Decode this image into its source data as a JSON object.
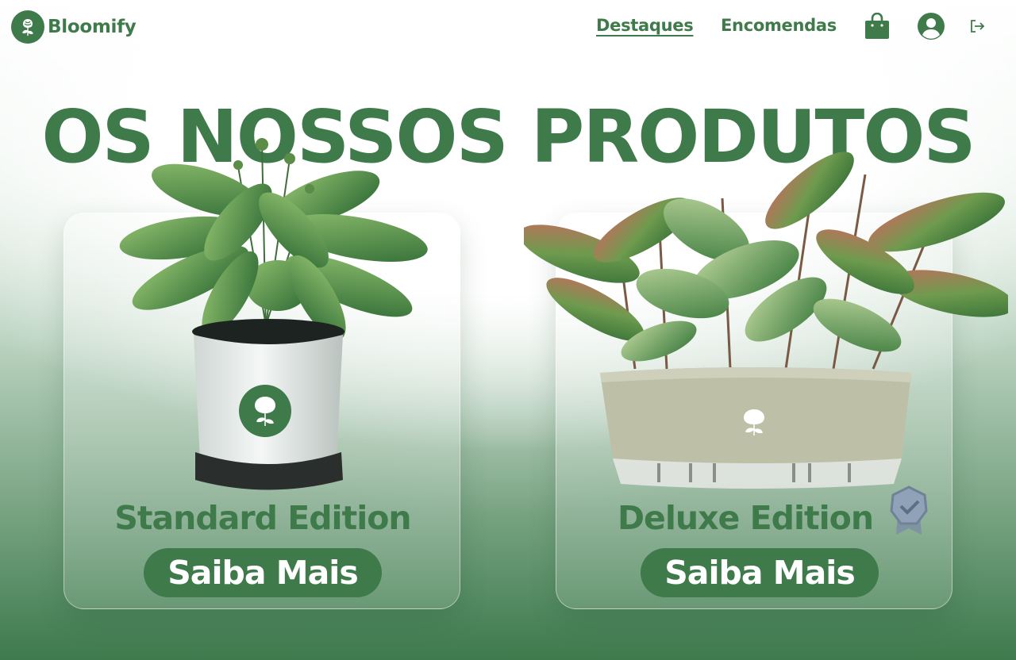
{
  "brand": {
    "name": "Bloomify"
  },
  "nav": {
    "items": [
      {
        "label": "Destaques",
        "active": true
      },
      {
        "label": "Encomendas",
        "active": false
      }
    ],
    "icons": [
      "shopping-bag-icon",
      "user-account-icon",
      "logout-icon"
    ]
  },
  "hero": {
    "title": "OS NOSSOS PRODUTOS"
  },
  "products": [
    {
      "name": "Standard Edition",
      "cta": "Saiba Mais"
    },
    {
      "name": "Deluxe Edition",
      "cta": "Saiba Mais",
      "badge": "award-ribbon-icon"
    }
  ],
  "colors": {
    "brand_green": "#3f7a4b",
    "background_white": "#ffffff",
    "background_green": "#3d7a4c"
  }
}
